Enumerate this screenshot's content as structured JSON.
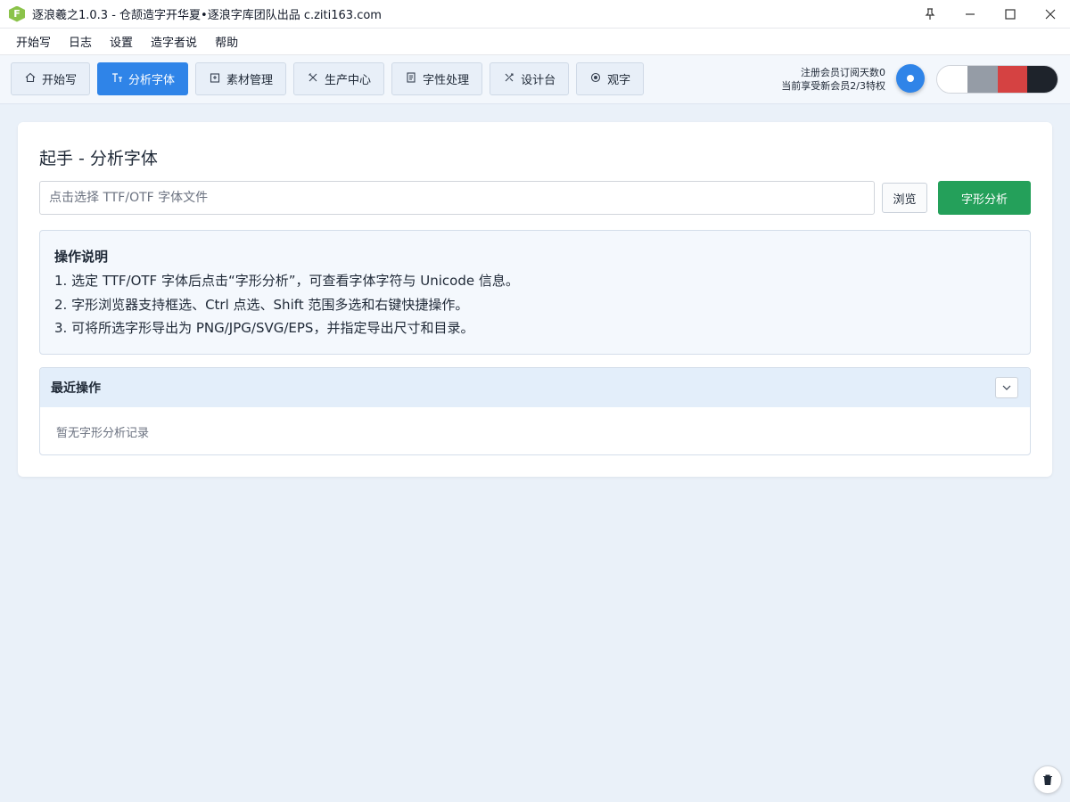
{
  "titlebar": {
    "logo_letter": "F",
    "title": "逐浪羲之1.0.3 - 仓颉造字开华夏•逐浪字库团队出品 c.ziti163.com",
    "pin_icon": "pin-icon",
    "minimize_icon": "minimize-icon",
    "maximize_icon": "maximize-icon",
    "close_icon": "close-icon"
  },
  "menu": {
    "items": [
      {
        "label": "开始写"
      },
      {
        "label": "日志"
      },
      {
        "label": "设置"
      },
      {
        "label": "造字者说"
      },
      {
        "label": "帮助"
      }
    ]
  },
  "toolbar": {
    "tabs": [
      {
        "label": "开始写",
        "icon": "home-icon",
        "active": false
      },
      {
        "label": "分析字体",
        "icon": "text-size-icon",
        "active": true
      },
      {
        "label": "素材管理",
        "icon": "material-box-icon",
        "active": false
      },
      {
        "label": "生产中心",
        "icon": "tools-icon",
        "active": false
      },
      {
        "label": "字性处理",
        "icon": "document-icon",
        "active": false
      },
      {
        "label": "设计台",
        "icon": "design-icon",
        "active": false
      },
      {
        "label": "观字",
        "icon": "eye-icon",
        "active": false
      }
    ],
    "member_line1": "注册会员订阅天数0",
    "member_line2": "当前享受新会员2/3特权",
    "theme_colors": [
      "#ffffff",
      "#959ca6",
      "#d54242",
      "#1e232b"
    ],
    "accent_color": "#2f84e8"
  },
  "main": {
    "card_title": "起手 - 分析字体",
    "file_input_placeholder": "点击选择 TTF/OTF 字体文件",
    "browse_label": "浏览",
    "analyze_label": "字形分析",
    "analyze_color": "#24a05a",
    "instructions": {
      "title": "操作说明",
      "lines": [
        "1. 选定 TTF/OTF 字体后点击“字形分析”，可查看字体字符与 Unicode 信息。",
        "2. 字形浏览器支持框选、Ctrl 点选、Shift 范围多选和右键快捷操作。",
        "3. 可将所选字形导出为 PNG/JPG/SVG/EPS，并指定导出尺寸和目录。"
      ]
    },
    "recent": {
      "title": "最近操作",
      "empty_text": "暂无字形分析记录",
      "collapse_icon": "chevron-down-icon"
    }
  },
  "corner_button_icon": "trash-icon"
}
